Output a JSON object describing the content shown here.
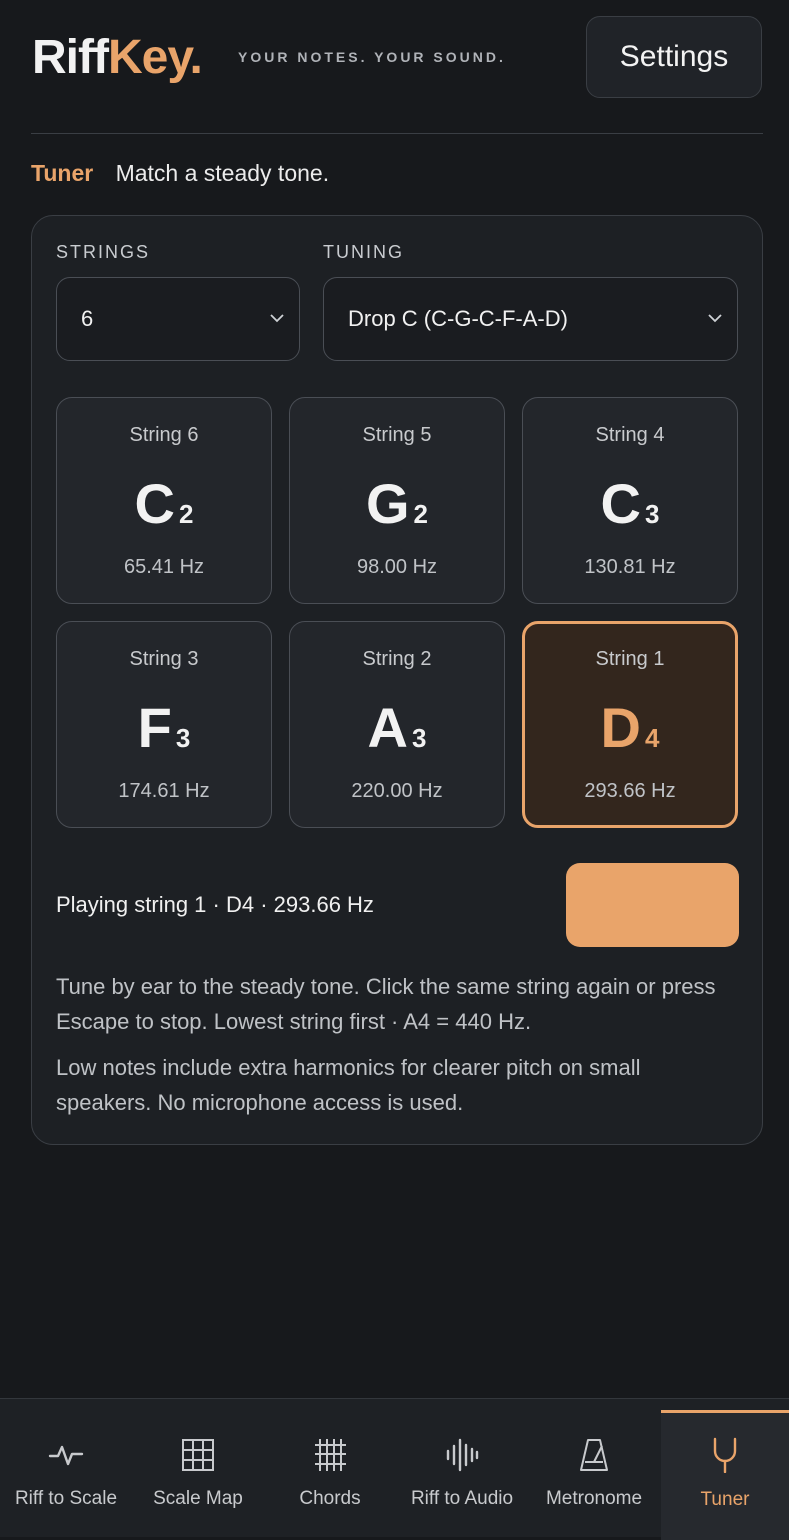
{
  "header": {
    "logo_part1": "Riff",
    "logo_part2": "Key.",
    "tagline": "YOUR NOTES. YOUR SOUND.",
    "settings_label": "Settings"
  },
  "section": {
    "title": "Tuner",
    "subtitle": "Match a steady tone."
  },
  "controls": {
    "strings_label": "STRINGS",
    "strings_value": "6",
    "tuning_label": "TUNING",
    "tuning_value": "Drop C (C-G-C-F-A-D)"
  },
  "strings": [
    {
      "label": "String 6",
      "note": "C",
      "octave": "2",
      "hz": "65.41 Hz"
    },
    {
      "label": "String 5",
      "note": "G",
      "octave": "2",
      "hz": "98.00 Hz"
    },
    {
      "label": "String 4",
      "note": "C",
      "octave": "3",
      "hz": "130.81 Hz"
    },
    {
      "label": "String 3",
      "note": "F",
      "octave": "3",
      "hz": "174.61 Hz"
    },
    {
      "label": "String 2",
      "note": "A",
      "octave": "3",
      "hz": "220.00 Hz"
    },
    {
      "label": "String 1",
      "note": "D",
      "octave": "4",
      "hz": "293.66 Hz"
    }
  ],
  "status": "Playing string 1 · D4 · 293.66 Hz",
  "help": [
    "Tune by ear to the steady tone. Click the same string again or press Escape to stop. Lowest string first · A4 = 440 Hz.",
    "Low notes include extra harmonics for clearer pitch on small speakers. No microphone access is used."
  ],
  "nav": [
    {
      "label": "Riff to Scale",
      "icon": "pulse-icon"
    },
    {
      "label": "Scale Map",
      "icon": "grid-icon"
    },
    {
      "label": "Chords",
      "icon": "fretboard-icon"
    },
    {
      "label": "Riff to Audio",
      "icon": "waveform-icon"
    },
    {
      "label": "Metronome",
      "icon": "metronome-icon"
    },
    {
      "label": "Tuner",
      "icon": "tuning-fork-icon"
    }
  ],
  "colors": {
    "accent": "#e9a46a",
    "background": "#17191c",
    "card": "#1d2024"
  }
}
